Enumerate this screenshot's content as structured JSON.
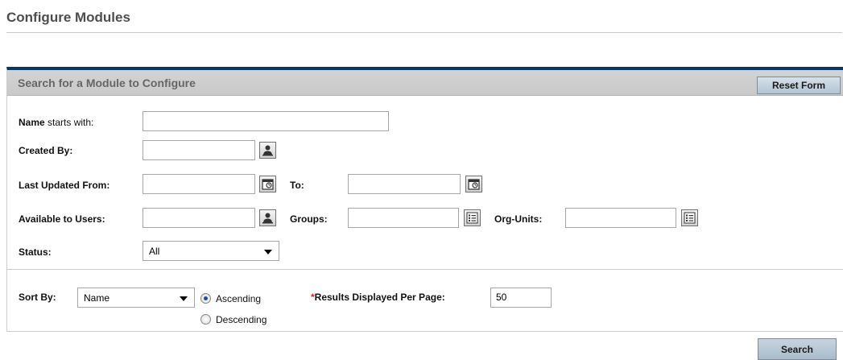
{
  "page": {
    "title": "Configure Modules"
  },
  "panel": {
    "title": "Search for a Module to Configure",
    "reset_label": "Reset Form"
  },
  "fields": {
    "name": {
      "label_bold": "Name",
      "label_rest": " starts with:",
      "value": ""
    },
    "created_by": {
      "label": "Created By:",
      "value": ""
    },
    "last_updated_from": {
      "label": "Last Updated From:",
      "value": ""
    },
    "to": {
      "label": "To:",
      "value": ""
    },
    "available_to_users": {
      "label": "Available to Users:",
      "value": ""
    },
    "groups": {
      "label": "Groups:",
      "value": ""
    },
    "org_units": {
      "label": "Org-Units:",
      "value": ""
    },
    "status": {
      "label": "Status:",
      "value": "All"
    }
  },
  "sort": {
    "label": "Sort By:",
    "value": "Name",
    "ascending_label": "Ascending",
    "descending_label": "Descending",
    "selected": "Ascending"
  },
  "results": {
    "required_mark": "*",
    "label": "Results Displayed Per Page:",
    "value": "50"
  },
  "actions": {
    "search_label": "Search"
  },
  "icons": {
    "created_by_picker": "user-lookup-icon",
    "date_from_picker": "calendar-icon",
    "date_to_picker": "calendar-icon",
    "users_picker": "user-lookup-icon",
    "groups_picker": "list-lookup-icon",
    "org_units_picker": "list-lookup-icon"
  },
  "colors": {
    "header_rule": "#0f3460",
    "panel_header_bg": "#cfcfcf",
    "button_bg": "#c3d2de",
    "required": "#dd2222"
  }
}
